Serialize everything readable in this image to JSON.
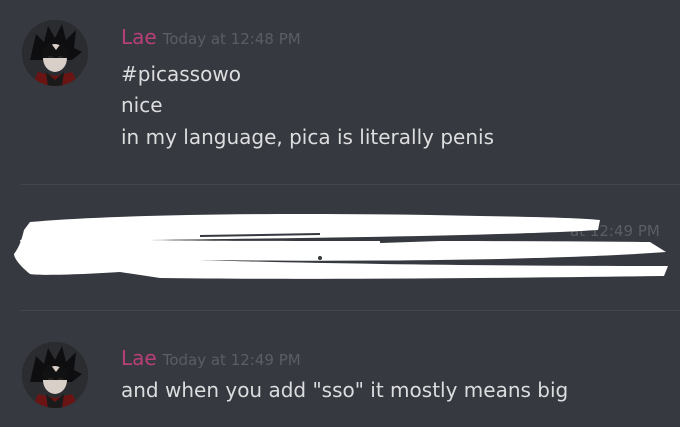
{
  "messages": [
    {
      "username": "Lae",
      "timestamp": "Today at 12:48 PM",
      "lines": [
        "#picassowo",
        "nice",
        "in my language, pica is literally penis"
      ]
    },
    {
      "timestamp_partial": "at 12:49 PM",
      "redacted": true
    },
    {
      "username": "Lae",
      "timestamp": "Today at 12:49 PM",
      "lines": [
        "and when you add \"sso\" it mostly means big"
      ]
    }
  ],
  "colors": {
    "background": "#36393f",
    "username": "#b83f78",
    "timestamp": "#5c5e66",
    "text": "#dcddde",
    "divider": "#42454a",
    "redaction": "#ffffff"
  },
  "icons": {
    "avatar": "user-avatar-icon"
  }
}
